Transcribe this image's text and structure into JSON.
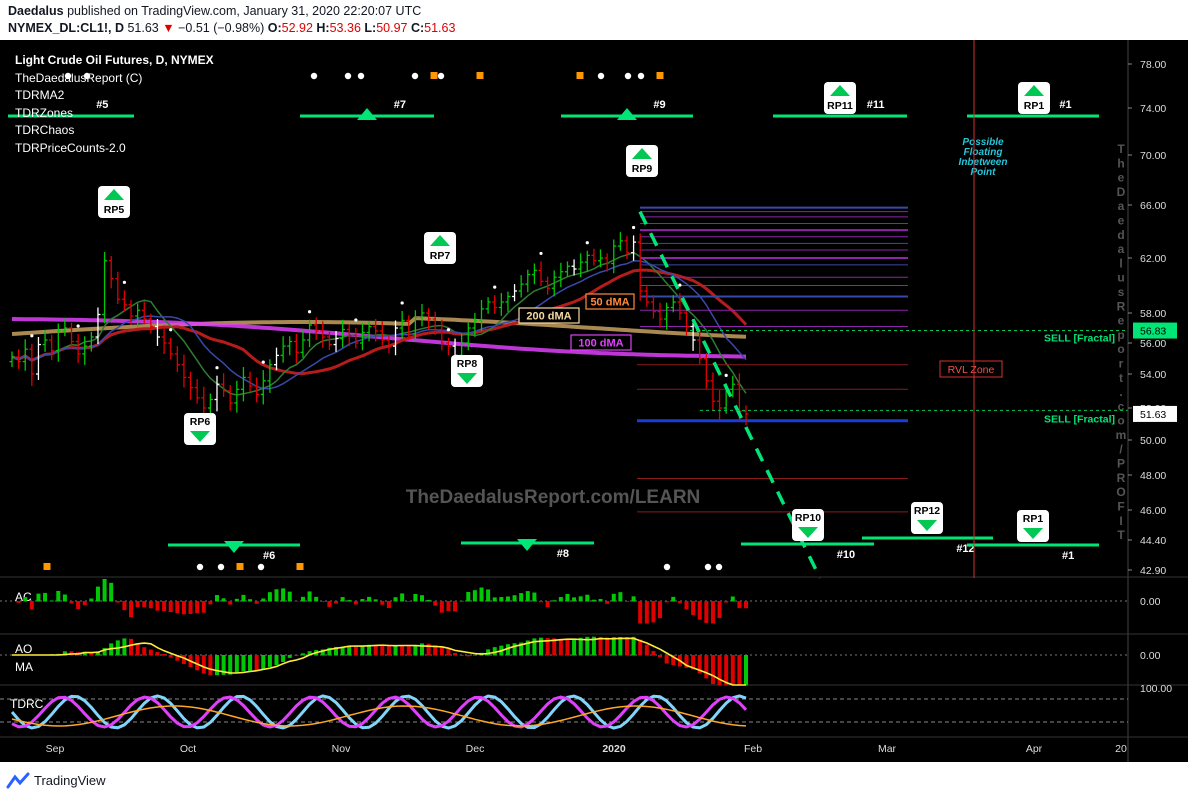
{
  "header": {
    "author": "Daedalus",
    "published_text": "published on TradingView.com, January 31, 2020 22:20:07 UTC",
    "symbol": "NYMEX_DL:CL1!, D",
    "last": "51.63",
    "change": "−0.51 (−0.98%)",
    "o_label": "O:",
    "o_val": "52.92",
    "h_label": "H:",
    "h_val": "53.36",
    "l_label": "L:",
    "l_val": "50.97",
    "c_label": "C:",
    "c_val": "51.63"
  },
  "legend": {
    "title": "Light Crude Oil Futures, D, NYMEX",
    "indicators": [
      "TheDaedalusReport (C)",
      "TDRMA2",
      "TDRZones",
      "TDRChaos",
      "TDRPriceCounts-2.0"
    ]
  },
  "watermark_center": "TheDaedalusReport.com/LEARN",
  "watermark_vertical": "TheDaedalusReport.com/PROFIT",
  "annotations": {
    "floating": [
      "Possible",
      "Floating",
      "Inbetween",
      "Point"
    ],
    "rvl": "RVL Zone",
    "sell_upper": "SELL [Fractal]",
    "sell_lower": "SELL [Fractal]",
    "ma50": "50 dMA",
    "ma100": "100 dMA",
    "ma200": "200 dMA"
  },
  "rp_labels": [
    {
      "label": "RP5",
      "dir": "up"
    },
    {
      "label": "RP6",
      "dir": "down"
    },
    {
      "label": "RP7",
      "dir": "up"
    },
    {
      "label": "RP8",
      "dir": "down"
    },
    {
      "label": "RP9",
      "dir": "up"
    },
    {
      "label": "RP10",
      "dir": "down"
    },
    {
      "label": "RP11",
      "dir": "up"
    },
    {
      "label": "RP12",
      "dir": "down"
    },
    {
      "label": "RP1",
      "dir": "up"
    },
    {
      "label": "RP1",
      "dir": "down"
    }
  ],
  "count_labels": [
    "#5",
    "#7",
    "#9",
    "#11",
    "#1",
    "#6",
    "#8",
    "#10",
    "#12",
    "#1"
  ],
  "panes": {
    "ac": "AC",
    "ao": "AO",
    "ma": "MA",
    "tdr": "TDRC"
  },
  "colors": {
    "up": "#00c805",
    "down": "#e00000",
    "accent": "#00e676",
    "ma50": "#e65100",
    "ma100": "#e040fb",
    "ma200": "#c8a060"
  },
  "footer": {
    "brand": "TradingView"
  },
  "chart_data": {
    "type": "candlestick",
    "title": "Light Crude Oil Futures, D, NYMEX",
    "x_ticks": [
      "Sep",
      "Oct",
      "Nov",
      "Dec",
      "2020",
      "Feb",
      "Mar",
      "Apr",
      "20"
    ],
    "y_ticks": [
      "78.00",
      "74.00",
      "70.00",
      "66.00",
      "62.00",
      "58.00",
      "56.00",
      "54.00",
      "52.00",
      "50.00",
      "48.00",
      "46.00",
      "44.40",
      "42.90"
    ],
    "y_range": [
      42.5,
      79
    ],
    "price_labels": [
      {
        "value": "56.83",
        "price": 56.83
      },
      {
        "value": "51.63",
        "price": 51.63
      }
    ],
    "close_series": [
      55.1,
      54.8,
      55.6,
      54.0,
      55.9,
      56.2,
      55.5,
      56.8,
      57.0,
      56.1,
      55.3,
      55.8,
      56.4,
      57.9,
      61.8,
      60.5,
      59.0,
      58.6,
      57.8,
      58.2,
      57.6,
      57.1,
      56.4,
      56.0,
      55.3,
      54.6,
      53.8,
      53.2,
      52.6,
      52.0,
      52.5,
      53.4,
      53.0,
      52.3,
      53.1,
      53.8,
      53.3,
      52.8,
      53.6,
      54.6,
      55.2,
      55.8,
      56.1,
      55.4,
      56.2,
      57.2,
      56.8,
      56.4,
      55.9,
      56.3,
      56.9,
      56.5,
      56.0,
      56.7,
      57.1,
      56.8,
      56.2,
      55.8,
      57.0,
      57.5,
      56.6,
      57.7,
      58.0,
      57.6,
      56.9,
      56.0,
      55.8,
      55.2,
      56.0,
      57.0,
      57.5,
      58.3,
      58.8,
      58.4,
      58.8,
      59.2,
      59.6,
      60.1,
      60.8,
      61.1,
      60.3,
      59.8,
      60.6,
      61.0,
      61.4,
      61.2,
      61.7,
      62.2,
      61.8,
      62.0,
      61.6,
      62.9,
      63.3,
      62.4,
      63.2,
      59.6,
      58.8,
      58.1,
      57.6,
      58.4,
      58.8,
      58.0,
      57.1,
      56.2,
      55.0,
      53.6,
      52.4,
      52.0,
      53.1,
      53.4,
      51.8,
      51.63
    ]
  }
}
